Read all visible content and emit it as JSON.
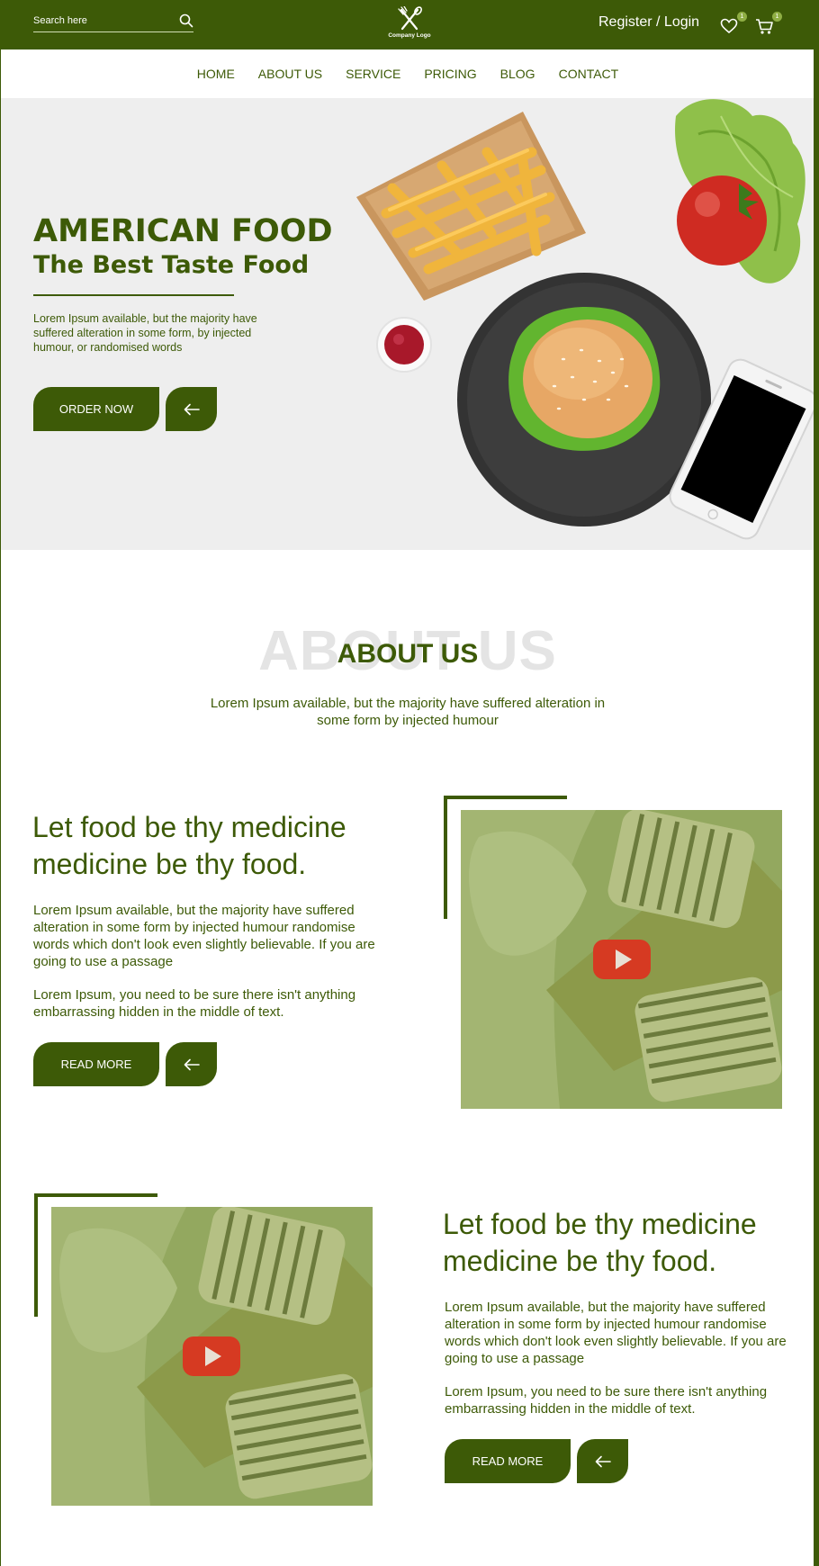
{
  "header": {
    "search_placeholder": "Search here",
    "logo_text": "Company Logo",
    "register_login": "Register / Login",
    "wishlist_count": "1",
    "cart_count": "1"
  },
  "nav": {
    "items": [
      "HOME",
      "ABOUT US",
      "SERVICE",
      "PRICING",
      "BLOG",
      "CONTACT"
    ]
  },
  "hero": {
    "title": "AMERICAN FOOD",
    "subtitle": "The Best Taste Food",
    "text": "Lorem Ipsum available, but the majority have suffered alteration in some form, by injected humour, or randomised words",
    "order_button": "ORDER NOW"
  },
  "about": {
    "background_word": "ABOUT US",
    "title": "ABOUT US",
    "text": "Lorem Ipsum available, but the majority have suffered alteration in some form by injected humour"
  },
  "features": [
    {
      "title_line1": "Let food be thy medicine",
      "title_line2": "medicine be thy food.",
      "paragraph1": "Lorem Ipsum available, but the majority have suffered alteration in some form by injected humour randomise words which don't look even slightly believable. If you are going to use a passage",
      "paragraph2": "Lorem Ipsum, you need to be sure there isn't anything embarrassing hidden in the middle of text.",
      "button": "READ MORE"
    },
    {
      "title_line1": "Let food be thy medicine",
      "title_line2": "medicine be thy food.",
      "paragraph1": "Lorem Ipsum available, but the majority have suffered alteration in some form by injected humour randomise words which don't look even slightly believable. If you are going to use a passage",
      "paragraph2": "Lorem Ipsum, you need to be sure there isn't anything embarrassing hidden in the middle of text.",
      "button": "READ MORE"
    }
  ],
  "colors": {
    "brand_green": "#3d5a07",
    "play_red": "#d63a22"
  },
  "icons": [
    "search-icon",
    "fork-knife-logo-icon",
    "heart-icon",
    "cart-icon",
    "arrow-left-icon",
    "play-icon"
  ]
}
